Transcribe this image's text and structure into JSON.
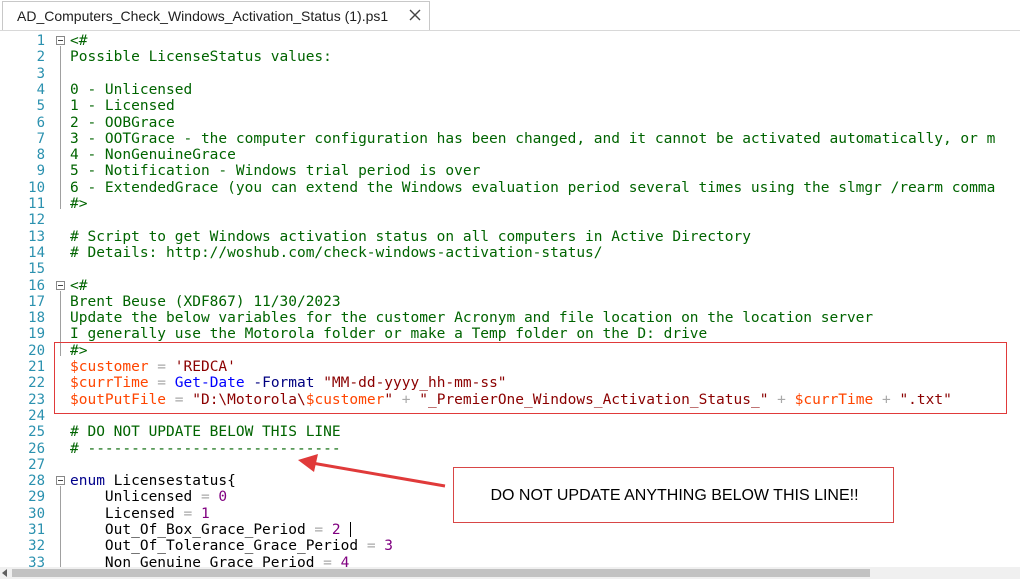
{
  "tab": {
    "title": "AD_Computers_Check_Windows_Activation_Status (1).ps1"
  },
  "colors": {
    "comment": "#006400",
    "variable": "#ff4500",
    "string": "#8b0000",
    "command": "#0000ff",
    "parameter": "#000080",
    "number": "#800080",
    "operator": "#a9a9a9",
    "keyword": "#00008b",
    "line_number": "#2b91af",
    "annotation_red": "#e03a3a"
  },
  "editor": {
    "lines": [
      {
        "n": "1",
        "tokens": [
          [
            "comment",
            "<#"
          ]
        ]
      },
      {
        "n": "2",
        "tokens": [
          [
            "comment",
            "Possible LicenseStatus values:"
          ]
        ]
      },
      {
        "n": "3",
        "tokens": []
      },
      {
        "n": "4",
        "tokens": [
          [
            "comment",
            "0 - Unlicensed"
          ]
        ]
      },
      {
        "n": "5",
        "tokens": [
          [
            "comment",
            "1 - Licensed"
          ]
        ]
      },
      {
        "n": "6",
        "tokens": [
          [
            "comment",
            "2 - OOBGrace"
          ]
        ]
      },
      {
        "n": "7",
        "tokens": [
          [
            "comment",
            "3 - OOTGrace - the computer configuration has been changed, and it cannot be activated automatically, or m"
          ]
        ]
      },
      {
        "n": "8",
        "tokens": [
          [
            "comment",
            "4 - NonGenuineGrace"
          ]
        ]
      },
      {
        "n": "9",
        "tokens": [
          [
            "comment",
            "5 - Notification - Windows trial period is over"
          ]
        ]
      },
      {
        "n": "10",
        "tokens": [
          [
            "comment",
            "6 - ExtendedGrace (you can extend the Windows evaluation period several times using the slmgr /rearm comma"
          ]
        ]
      },
      {
        "n": "11",
        "tokens": [
          [
            "comment",
            "#>"
          ]
        ]
      },
      {
        "n": "12",
        "tokens": []
      },
      {
        "n": "13",
        "tokens": [
          [
            "comment",
            "# Script to get Windows activation status on all computers in Active Directory"
          ]
        ]
      },
      {
        "n": "14",
        "tokens": [
          [
            "comment",
            "# Details: http://woshub.com/check-windows-activation-status/"
          ]
        ]
      },
      {
        "n": "15",
        "tokens": []
      },
      {
        "n": "16",
        "tokens": [
          [
            "comment",
            "<#"
          ]
        ]
      },
      {
        "n": "17",
        "tokens": [
          [
            "comment",
            "Brent Beuse (XDF867) 11/30/2023"
          ]
        ]
      },
      {
        "n": "18",
        "tokens": [
          [
            "comment",
            "Update the below variables for the customer Acronym and file location on the location server"
          ]
        ]
      },
      {
        "n": "19",
        "tokens": [
          [
            "comment",
            "I generally use the Motorola folder or make a Temp folder on the D: drive"
          ]
        ]
      },
      {
        "n": "20",
        "tokens": [
          [
            "comment",
            "#>"
          ]
        ]
      },
      {
        "n": "21",
        "tokens": [
          [
            "var",
            "$customer"
          ],
          [
            "op",
            " = "
          ],
          [
            "str",
            "'REDCA'"
          ]
        ]
      },
      {
        "n": "22",
        "tokens": [
          [
            "var",
            "$currTime"
          ],
          [
            "op",
            " = "
          ],
          [
            "cmd",
            "Get-Date"
          ],
          [
            "txt",
            " "
          ],
          [
            "param",
            "-Format"
          ],
          [
            "txt",
            " "
          ],
          [
            "str",
            "\"MM-dd-yyyy_hh-mm-ss\""
          ]
        ]
      },
      {
        "n": "23",
        "tokens": [
          [
            "var",
            "$outPutFile"
          ],
          [
            "op",
            " = "
          ],
          [
            "str",
            "\"D:\\Motorola\\"
          ],
          [
            "var",
            "$customer"
          ],
          [
            "str",
            "\""
          ],
          [
            "op",
            " + "
          ],
          [
            "str",
            "\"_PremierOne_Windows_Activation_Status_\""
          ],
          [
            "op",
            " + "
          ],
          [
            "var",
            "$currTime"
          ],
          [
            "op",
            " + "
          ],
          [
            "str",
            "\".txt\""
          ]
        ]
      },
      {
        "n": "24",
        "tokens": []
      },
      {
        "n": "25",
        "tokens": [
          [
            "comment",
            "# DO NOT UPDATE BELOW THIS LINE"
          ]
        ]
      },
      {
        "n": "26",
        "tokens": [
          [
            "comment",
            "# -----------------------------"
          ]
        ]
      },
      {
        "n": "27",
        "tokens": []
      },
      {
        "n": "28",
        "tokens": [
          [
            "kw",
            "enum"
          ],
          [
            "txt",
            " Licensestatus{"
          ]
        ]
      },
      {
        "n": "29",
        "tokens": [
          [
            "txt",
            "    Unlicensed"
          ],
          [
            "op",
            " = "
          ],
          [
            "num",
            "0"
          ]
        ]
      },
      {
        "n": "30",
        "tokens": [
          [
            "txt",
            "    Licensed"
          ],
          [
            "op",
            " = "
          ],
          [
            "num",
            "1"
          ]
        ]
      },
      {
        "n": "31",
        "tokens": [
          [
            "txt",
            "    Out_Of_Box_Grace_Period"
          ],
          [
            "op",
            " = "
          ],
          [
            "num",
            "2"
          ]
        ]
      },
      {
        "n": "32",
        "tokens": [
          [
            "txt",
            "    Out_Of_Tolerance_Grace_Period"
          ],
          [
            "op",
            " = "
          ],
          [
            "num",
            "3"
          ]
        ]
      },
      {
        "n": "33",
        "tokens": [
          [
            "txt",
            "    Non_Genuine_Grace_Period"
          ],
          [
            "op",
            " = "
          ],
          [
            "num",
            "4"
          ]
        ]
      }
    ]
  },
  "annotation": {
    "callout_text": "DO NOT UPDATE ANYTHING BELOW THIS LINE!!"
  }
}
